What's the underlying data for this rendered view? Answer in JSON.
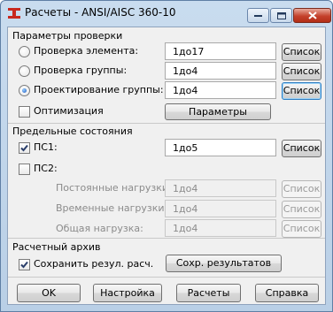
{
  "window": {
    "title": "Расчеты - ANSI/AISC 360-10"
  },
  "check_params": {
    "title": "Параметры проверки",
    "items": [
      {
        "label": "Проверка элемента:",
        "value": "1до17",
        "button": "Список",
        "selected": false
      },
      {
        "label": "Проверка группы:",
        "value": "1до4",
        "button": "Список",
        "selected": false
      },
      {
        "label": "Проектирование группы:",
        "value": "1до4",
        "button": "Список",
        "selected": true
      }
    ],
    "optimization_label": "Оптимизация",
    "optimization_checked": false,
    "params_button": "Параметры"
  },
  "limit_states": {
    "title": "Предельные состояния",
    "ps1": {
      "label": "ПС1:",
      "checked": true,
      "value": "1до5",
      "button": "Список"
    },
    "ps2": {
      "label": "ПС2:",
      "checked": false
    },
    "loads": [
      {
        "label": "Постоянные нагрузки:",
        "value": "1до4",
        "button": "Список"
      },
      {
        "label": "Временные нагрузки:",
        "value": "1до4",
        "button": "Список"
      },
      {
        "label": "Общая нагрузка:",
        "value": "1до4",
        "button": "Список"
      }
    ]
  },
  "archive": {
    "title": "Расчетный архив",
    "save_label": "Сохранить резул. расч.",
    "save_checked": true,
    "save_results_button": "Сохр. результатов"
  },
  "footer": {
    "ok": "OK",
    "settings": "Настройка",
    "calc": "Расчеты",
    "help": "Справка"
  },
  "colors": {
    "title_bar": "#c9dcef",
    "close_button": "#c4412c",
    "dialog_bg": "#f0f0f0",
    "focus_border": "#2f7fc4"
  }
}
